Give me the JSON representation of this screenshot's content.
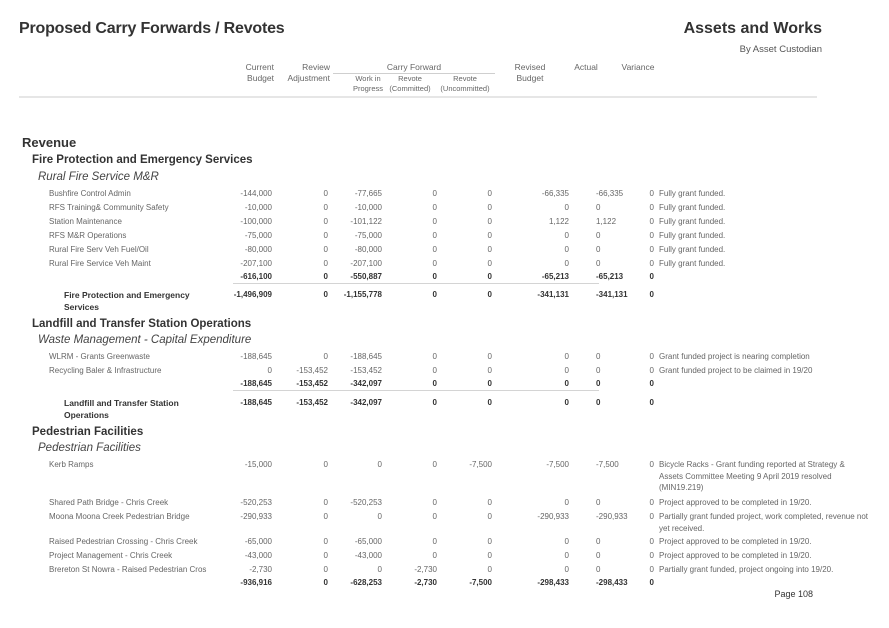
{
  "header": {
    "title": "Proposed Carry Forwards / Revotes",
    "department": "Assets and Works",
    "subtitle": "By Asset Custodian"
  },
  "columns": {
    "current_budget": [
      "Current",
      "Budget"
    ],
    "review_adjustment": [
      "Review",
      "Adjustment"
    ],
    "carry_forward_group": "Carry Forward",
    "work_in_progress": [
      "Work in",
      "Progress"
    ],
    "revote_committed": [
      "Revote",
      "(Committed)"
    ],
    "revote_uncommitted": [
      "Revote",
      "(Uncommitted)"
    ],
    "revised_budget": [
      "Revised",
      "Budget"
    ],
    "actual": "Actual",
    "variance": "Variance"
  },
  "section": "Revenue",
  "groups": [
    {
      "name": "Fire Protection and Emergency Services",
      "subgroup": "Rural Fire Service M&R",
      "rows": [
        {
          "label": "Bushfire Control Admin",
          "values": [
            "-144,000",
            "0",
            "-77,665",
            "0",
            "0",
            "-66,335",
            "-66,335",
            "0"
          ],
          "comment": "Fully grant funded."
        },
        {
          "label": "RFS Training& Community Safety",
          "values": [
            "-10,000",
            "0",
            "-10,000",
            "0",
            "0",
            "0",
            "0",
            "0"
          ],
          "comment": "Fully grant funded."
        },
        {
          "label": "Station Maintenance",
          "values": [
            "-100,000",
            "0",
            "-101,122",
            "0",
            "0",
            "1,122",
            "1,122",
            "0"
          ],
          "comment": "Fully grant funded."
        },
        {
          "label": "RFS M&R Operations",
          "values": [
            "-75,000",
            "0",
            "-75,000",
            "0",
            "0",
            "0",
            "0",
            "0"
          ],
          "comment": "Fully grant funded."
        },
        {
          "label": "Rural Fire Serv Veh Fuel/Oil",
          "values": [
            "-80,000",
            "0",
            "-80,000",
            "0",
            "0",
            "0",
            "0",
            "0"
          ],
          "comment": "Fully grant funded."
        },
        {
          "label": "Rural Fire Service Veh Maint",
          "values": [
            "-207,100",
            "0",
            "-207,100",
            "0",
            "0",
            "0",
            "0",
            "0"
          ],
          "comment": "Fully grant funded."
        }
      ],
      "subtotal": [
        "-616,100",
        "0",
        "-550,887",
        "0",
        "0",
        "-65,213",
        "-65,213",
        "0"
      ],
      "total_label": "Fire Protection and Emergency Services",
      "total": [
        "-1,496,909",
        "0",
        "-1,155,778",
        "0",
        "0",
        "-341,131",
        "-341,131",
        "0"
      ]
    },
    {
      "name": "Landfill and Transfer Station Operations",
      "subgroup": "Waste Management - Capital Expenditure",
      "rows": [
        {
          "label": "WLRM - Grants Greenwaste",
          "values": [
            "-188,645",
            "0",
            "-188,645",
            "0",
            "0",
            "0",
            "0",
            "0"
          ],
          "comment": "Grant funded project is nearing completion"
        },
        {
          "label": "Recycling Baler & Infrastructure",
          "values": [
            "0",
            "-153,452",
            "-153,452",
            "0",
            "0",
            "0",
            "0",
            "0"
          ],
          "comment": "Grant funded project to be claimed in 19/20"
        }
      ],
      "subtotal": [
        "-188,645",
        "-153,452",
        "-342,097",
        "0",
        "0",
        "0",
        "0",
        "0"
      ],
      "total_label": "Landfill and Transfer Station Operations",
      "total": [
        "-188,645",
        "-153,452",
        "-342,097",
        "0",
        "0",
        "0",
        "0",
        "0"
      ]
    },
    {
      "name": "Pedestrian Facilities",
      "subgroup": "Pedestrian Facilities",
      "rows": [
        {
          "label": "Kerb Ramps",
          "values": [
            "-15,000",
            "0",
            "0",
            "0",
            "-7,500",
            "-7,500",
            "-7,500",
            "0"
          ],
          "comment": "Bicycle Racks - Grant funding reported at Strategy & Assets Committee Meeting 9 April 2019 resolved (MIN19.219)"
        },
        {
          "label": "Shared Path Bridge - Chris Creek",
          "values": [
            "-520,253",
            "0",
            "-520,253",
            "0",
            "0",
            "0",
            "0",
            "0"
          ],
          "comment": "Project approved to be completed in 19/20."
        },
        {
          "label": "Moona Moona Creek Pedestrian Bridge",
          "values": [
            "-290,933",
            "0",
            "0",
            "0",
            "0",
            "-290,933",
            "-290,933",
            "0"
          ],
          "comment": "Partially grant funded project, work completed, revenue not yet received."
        },
        {
          "label": "Raised Pedestrian Crossing - Chris Creek",
          "values": [
            "-65,000",
            "0",
            "-65,000",
            "0",
            "0",
            "0",
            "0",
            "0"
          ],
          "comment": "Project approved to be completed in 19/20."
        },
        {
          "label": "Project Management - Chris Creek",
          "values": [
            "-43,000",
            "0",
            "-43,000",
            "0",
            "0",
            "0",
            "0",
            "0"
          ],
          "comment": "Project approved to be completed in 19/20."
        },
        {
          "label": "Brereton St Nowra - Raised Pedestrian Cros",
          "values": [
            "-2,730",
            "0",
            "0",
            "-2,730",
            "0",
            "0",
            "0",
            "0"
          ],
          "comment": "Partially grant funded, project ongoing into 19/20."
        }
      ],
      "subtotal": [
        "-936,916",
        "0",
        "-628,253",
        "-2,730",
        "-7,500",
        "-298,433",
        "-298,433",
        "0"
      ]
    }
  ],
  "footer": {
    "page": "Page 108"
  }
}
